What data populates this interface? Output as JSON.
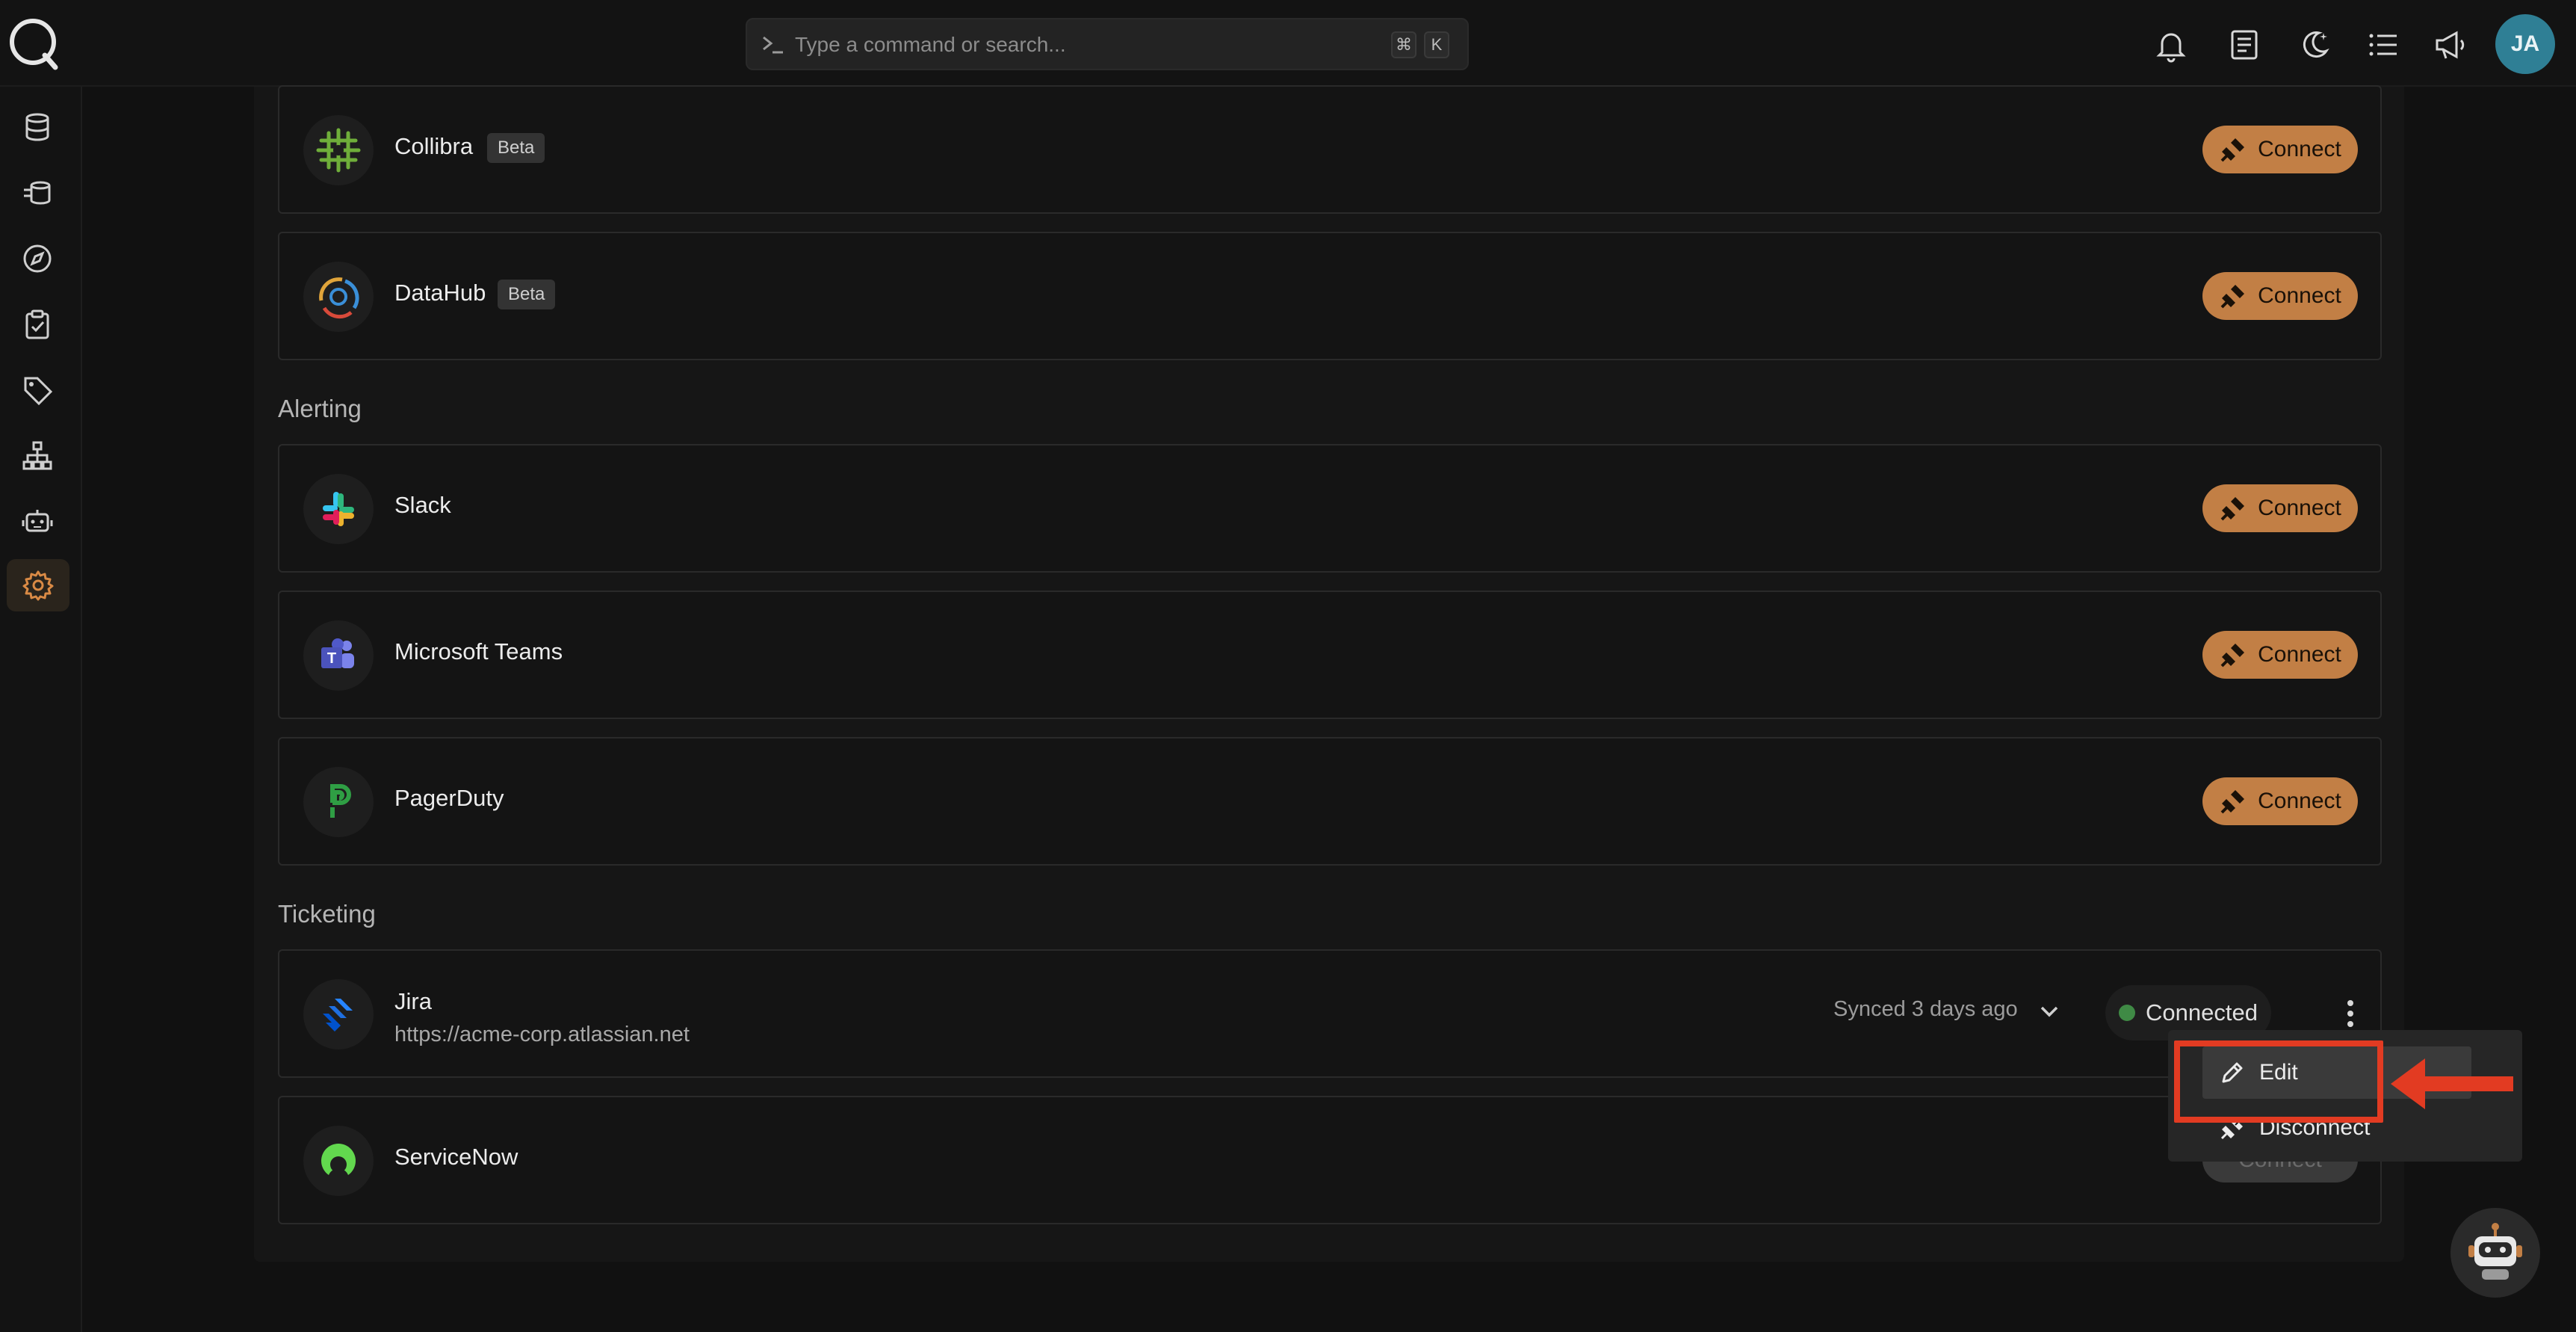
{
  "search": {
    "placeholder": "Type a command or search...",
    "kbd_cmd": "⌘",
    "kbd_k": "K"
  },
  "header": {
    "icons": [
      "bell-icon",
      "document-icon",
      "moon-icon",
      "list-icon",
      "megaphone-icon"
    ],
    "avatar_initials": "JA"
  },
  "sidebar": {
    "items": [
      "database-icon",
      "data-stack-icon",
      "compass-icon",
      "clipboard-check-icon",
      "tag-icon",
      "hierarchy-icon",
      "robot-icon",
      "gear-icon"
    ],
    "active": "gear-icon"
  },
  "sections": {
    "alerting": "Alerting",
    "ticketing": "Ticketing"
  },
  "integrations": {
    "collibra": {
      "name": "Collibra",
      "badge": "Beta",
      "action": "Connect"
    },
    "datahub": {
      "name": "DataHub",
      "badge": "Beta",
      "action": "Connect"
    },
    "slack": {
      "name": "Slack",
      "action": "Connect"
    },
    "teams": {
      "name": "Microsoft Teams",
      "action": "Connect"
    },
    "pagerduty": {
      "name": "PagerDuty",
      "action": "Connect"
    },
    "jira": {
      "name": "Jira",
      "url": "https://acme-corp.atlassian.net",
      "synced": "Synced 3 days ago",
      "status": "Connected"
    },
    "servicenow": {
      "name": "ServiceNow",
      "action": "Connect"
    }
  },
  "menu": {
    "edit": "Edit",
    "disconnect": "Disconnect"
  },
  "colors": {
    "accent": "#c27f45",
    "connected_dot": "#3f8a45",
    "highlight": "#e23b22",
    "avatar": "#2f7f95"
  }
}
